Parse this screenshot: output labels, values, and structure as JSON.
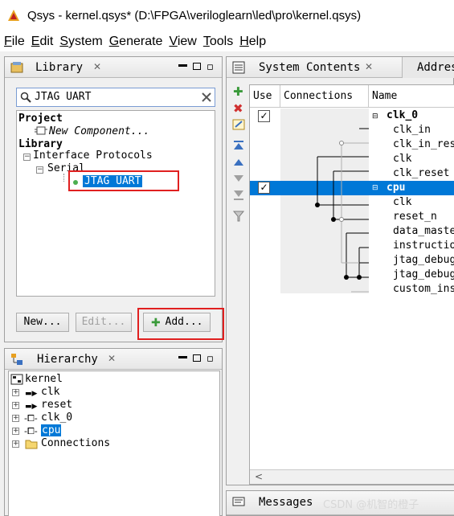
{
  "window": {
    "title": "Qsys - kernel.qsys* (D:\\FPGA\\veriloglearn\\led\\pro\\kernel.qsys)"
  },
  "menu": [
    {
      "label": "File",
      "key": "F"
    },
    {
      "label": "Edit",
      "key": "E"
    },
    {
      "label": "System",
      "key": "S"
    },
    {
      "label": "Generate",
      "key": "G"
    },
    {
      "label": "View",
      "key": "V"
    },
    {
      "label": "Tools",
      "key": "T"
    },
    {
      "label": "Help",
      "key": "H"
    }
  ],
  "library": {
    "tab_label": "Library",
    "tab_close": "✕",
    "search_value": "JTAG UART",
    "tree": {
      "project_label": "Project",
      "new_component_label": "New Component...",
      "library_label": "Library",
      "interface_protocols_label": "Interface Protocols",
      "serial_label": "Serial",
      "selected_item_label": "JTAG UART"
    },
    "buttons": {
      "new": "New...",
      "edit": "Edit...",
      "add": "Add..."
    }
  },
  "hierarchy": {
    "tab_label": "Hierarchy",
    "root_label": "kernel",
    "items": [
      "clk",
      "reset",
      "clk_0",
      "cpu",
      "Connections"
    ]
  },
  "system_contents": {
    "tab_label": "System Contents",
    "address_tab_label": "Addres",
    "columns": {
      "use": "Use",
      "connections": "Connections",
      "name": "Name"
    },
    "rows": [
      {
        "name": "clk_0",
        "bold": true
      },
      {
        "name": "clk_in"
      },
      {
        "name": "clk_in_res"
      },
      {
        "name": "clk"
      },
      {
        "name": "clk_reset"
      },
      {
        "name": "cpu",
        "bold": true,
        "selected": true
      },
      {
        "name": "clk"
      },
      {
        "name": "reset_n"
      },
      {
        "name": "data_maste"
      },
      {
        "name": "instructio"
      },
      {
        "name": "jtag_debug"
      },
      {
        "name": "jtag_debug"
      },
      {
        "name": "custom_ins"
      }
    ],
    "scroll_left": "<"
  },
  "messages": {
    "tab_label": "Messages"
  },
  "watermark": "CSDN @机智的橙子",
  "colors": {
    "selection": "#0078d7",
    "highlight_box": "#e02020"
  }
}
